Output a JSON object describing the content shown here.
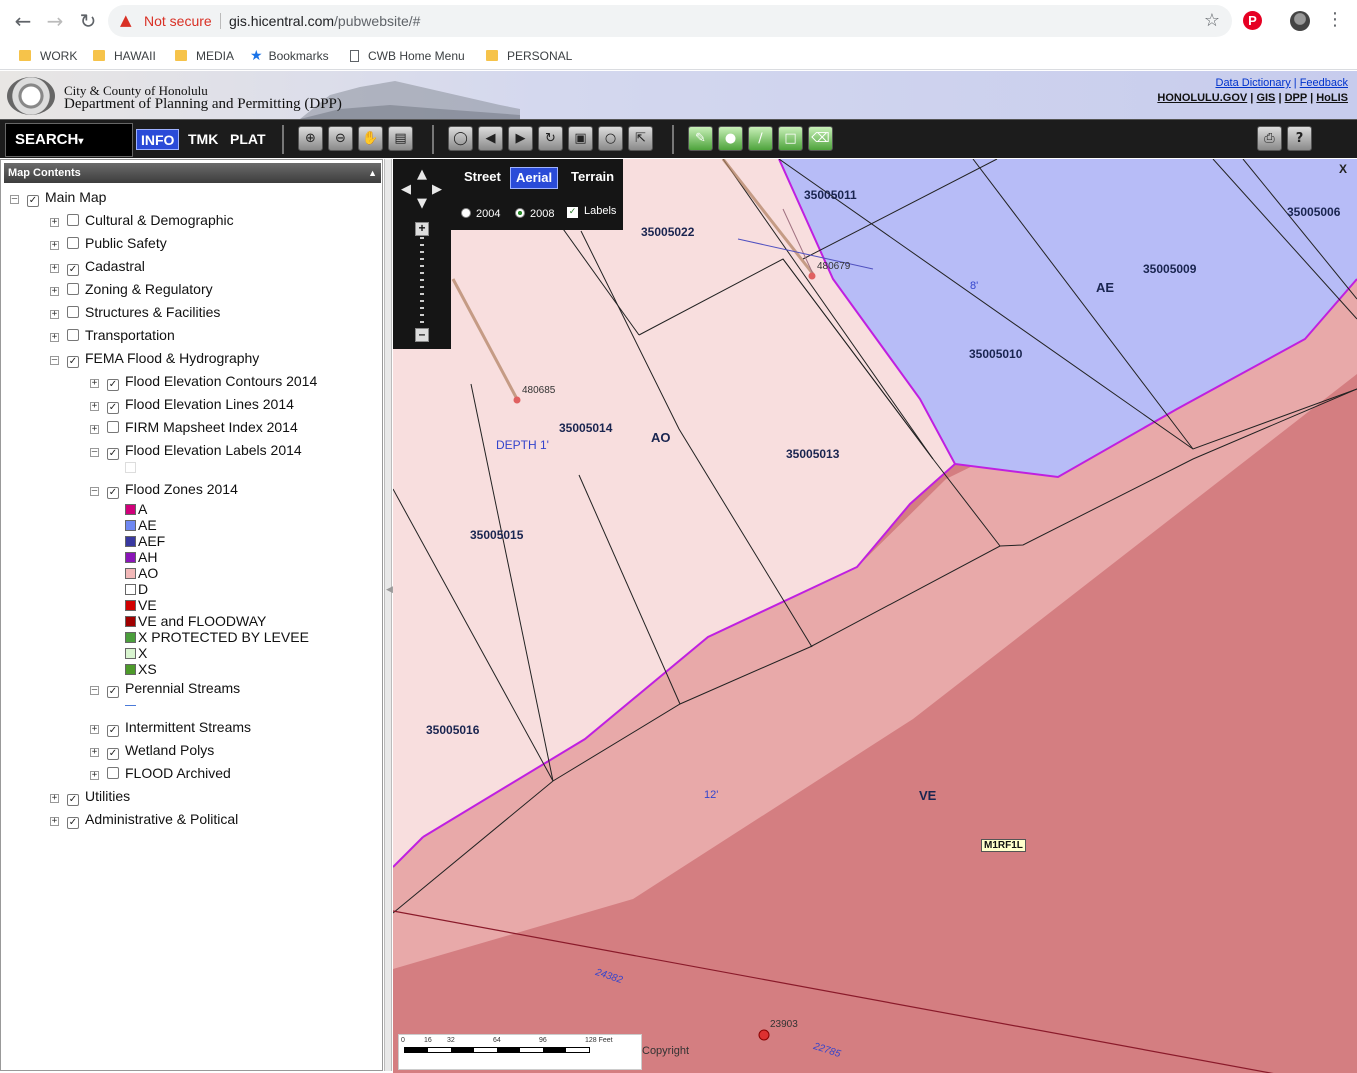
{
  "browser": {
    "not_secure": "Not secure",
    "url_host": "gis.hicentral.com",
    "url_path": "/pubwebsite/#",
    "bookmarks": [
      "WORK",
      "HAWAII",
      "MEDIA",
      "Bookmarks",
      "CWB Home Menu",
      "PERSONAL"
    ]
  },
  "banner": {
    "city": "City & County of Honolulu",
    "dept": "Department of Planning and Permitting (DPP)",
    "link_data_dictionary": "Data Dictionary",
    "link_feedback": "Feedback",
    "link_honolulu": "HONOLULU.GOV",
    "link_gis": "GIS",
    "link_dpp": "DPP",
    "link_holis": "HoLIS",
    "sep": "|"
  },
  "toolbar": {
    "search": "SEARCH",
    "tab_info": "INFO",
    "tab_tmk": "TMK",
    "tab_plat": "PLAT"
  },
  "panel": {
    "title": "Map Contents",
    "main_map": "Main Map",
    "layers": {
      "cultural": "Cultural & Demographic",
      "public_safety": "Public Safety",
      "cadastral": "Cadastral",
      "zoning": "Zoning & Regulatory",
      "structures": "Structures & Facilities",
      "transportation": "Transportation",
      "fema": "FEMA Flood & Hydrography",
      "contours": "Flood Elevation Contours 2014",
      "lines": "Flood Elevation Lines 2014",
      "firm": "FIRM Mapsheet Index 2014",
      "labels": "Flood Elevation Labels 2014",
      "zones": "Flood Zones 2014",
      "perennial": "Perennial Streams",
      "intermittent": "Intermittent Streams",
      "wetland": "Wetland Polys",
      "flood_archived": "FLOOD Archived",
      "utilities": "Utilities",
      "admin": "Administrative & Political"
    },
    "zone_legend": [
      {
        "label": "A",
        "color": "#d0007a"
      },
      {
        "label": "AE",
        "color": "#6f88f2"
      },
      {
        "label": "AEF",
        "color": "#3838a0"
      },
      {
        "label": "AH",
        "color": "#8a14b8"
      },
      {
        "label": "AO",
        "color": "#f2b8b8"
      },
      {
        "label": "D",
        "color": "#ffffff"
      },
      {
        "label": "VE",
        "color": "#d10000"
      },
      {
        "label": "VE and FLOODWAY",
        "color": "#a00000"
      },
      {
        "label": "X PROTECTED BY LEVEE",
        "color": "#4b9e3c"
      },
      {
        "label": "X",
        "color": "#d9f5d0"
      },
      {
        "label": "XS",
        "color": "#4d9a2a"
      }
    ]
  },
  "map": {
    "basemaps": {
      "street": "Street",
      "aerial": "Aerial",
      "terrain": "Terrain"
    },
    "years": {
      "y2004": "2004",
      "y2008": "2008"
    },
    "labels_toggle": "Labels",
    "parcels": {
      "p1": "35005011",
      "p2": "35005022",
      "p3": "35005006",
      "p4": "35005009",
      "p5": "35005010",
      "p6": "35005014",
      "p7": "35005013",
      "p8": "35005015",
      "p9": "35005016"
    },
    "points": {
      "pt1": "480679",
      "pt2": "480685",
      "pt3": "23903"
    },
    "depth": "DEPTH 1'",
    "zone_ao": "AO",
    "zone_ae": "AE",
    "zone_ve": "VE",
    "elev_8": "8'",
    "elev_12": "12'",
    "contour_a": "24382",
    "contour_b": "22785",
    "firm_panel": "M1RF1L",
    "corner_x": "X",
    "scale_unit": "128 Feet",
    "scale_ticks": [
      "0",
      "16",
      "32",
      "64",
      "96"
    ],
    "copyright": "Copyright"
  }
}
